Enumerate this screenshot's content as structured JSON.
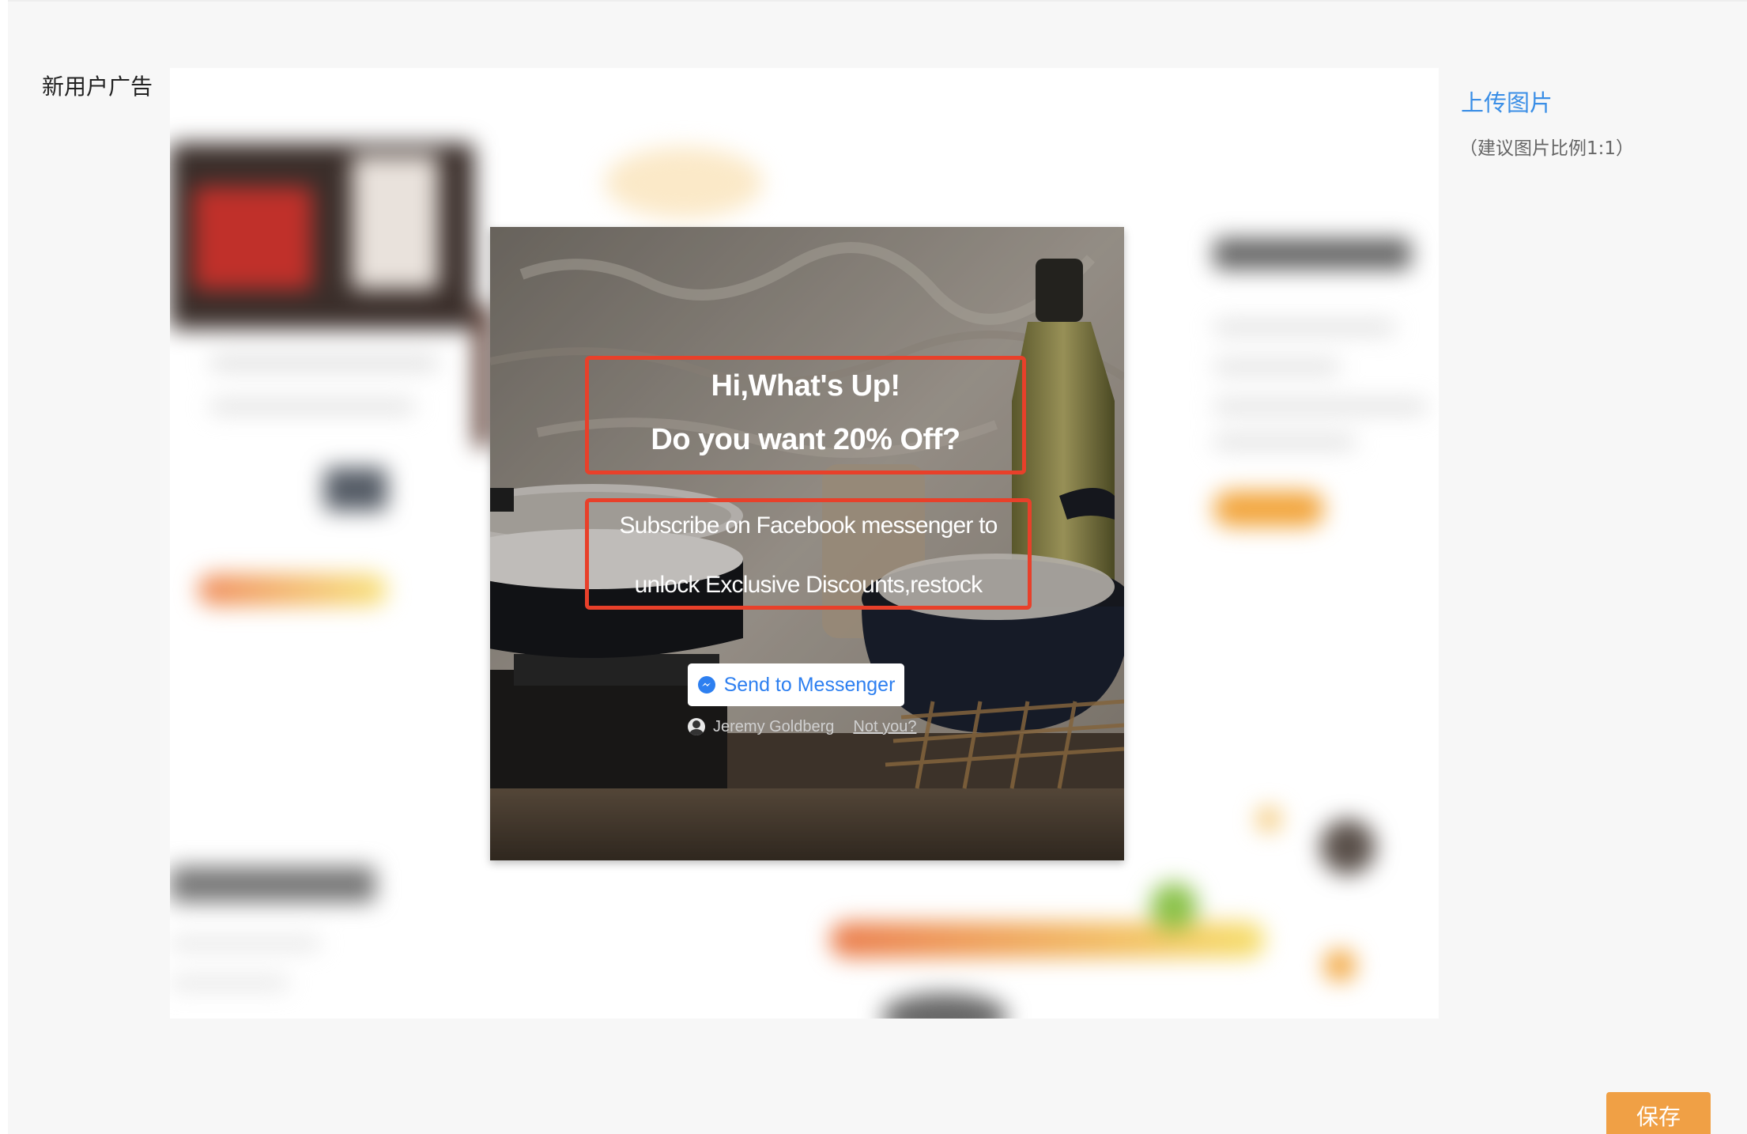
{
  "section": {
    "label": "新用户广告"
  },
  "popup": {
    "headline_line1": "Hi,What's Up!",
    "headline_line2": "Do you want 20% Off?",
    "subtext_line1": "Subscribe on Facebook messenger to",
    "subtext_line2": "unlock Exclusive Discounts,restock",
    "messenger_button": "Send to Messenger",
    "user_name": "Jeremy Goldberg",
    "not_you": "Not you?"
  },
  "sidebar": {
    "upload_label": "上传图片",
    "upload_hint": "（建议图片比例1:1）"
  },
  "actions": {
    "save_label": "保存"
  },
  "colors": {
    "highlight_border": "#e8402a",
    "link_blue": "#3a8ee6",
    "messenger_blue": "#2d7ff0",
    "save_orange": "#f0a045"
  }
}
